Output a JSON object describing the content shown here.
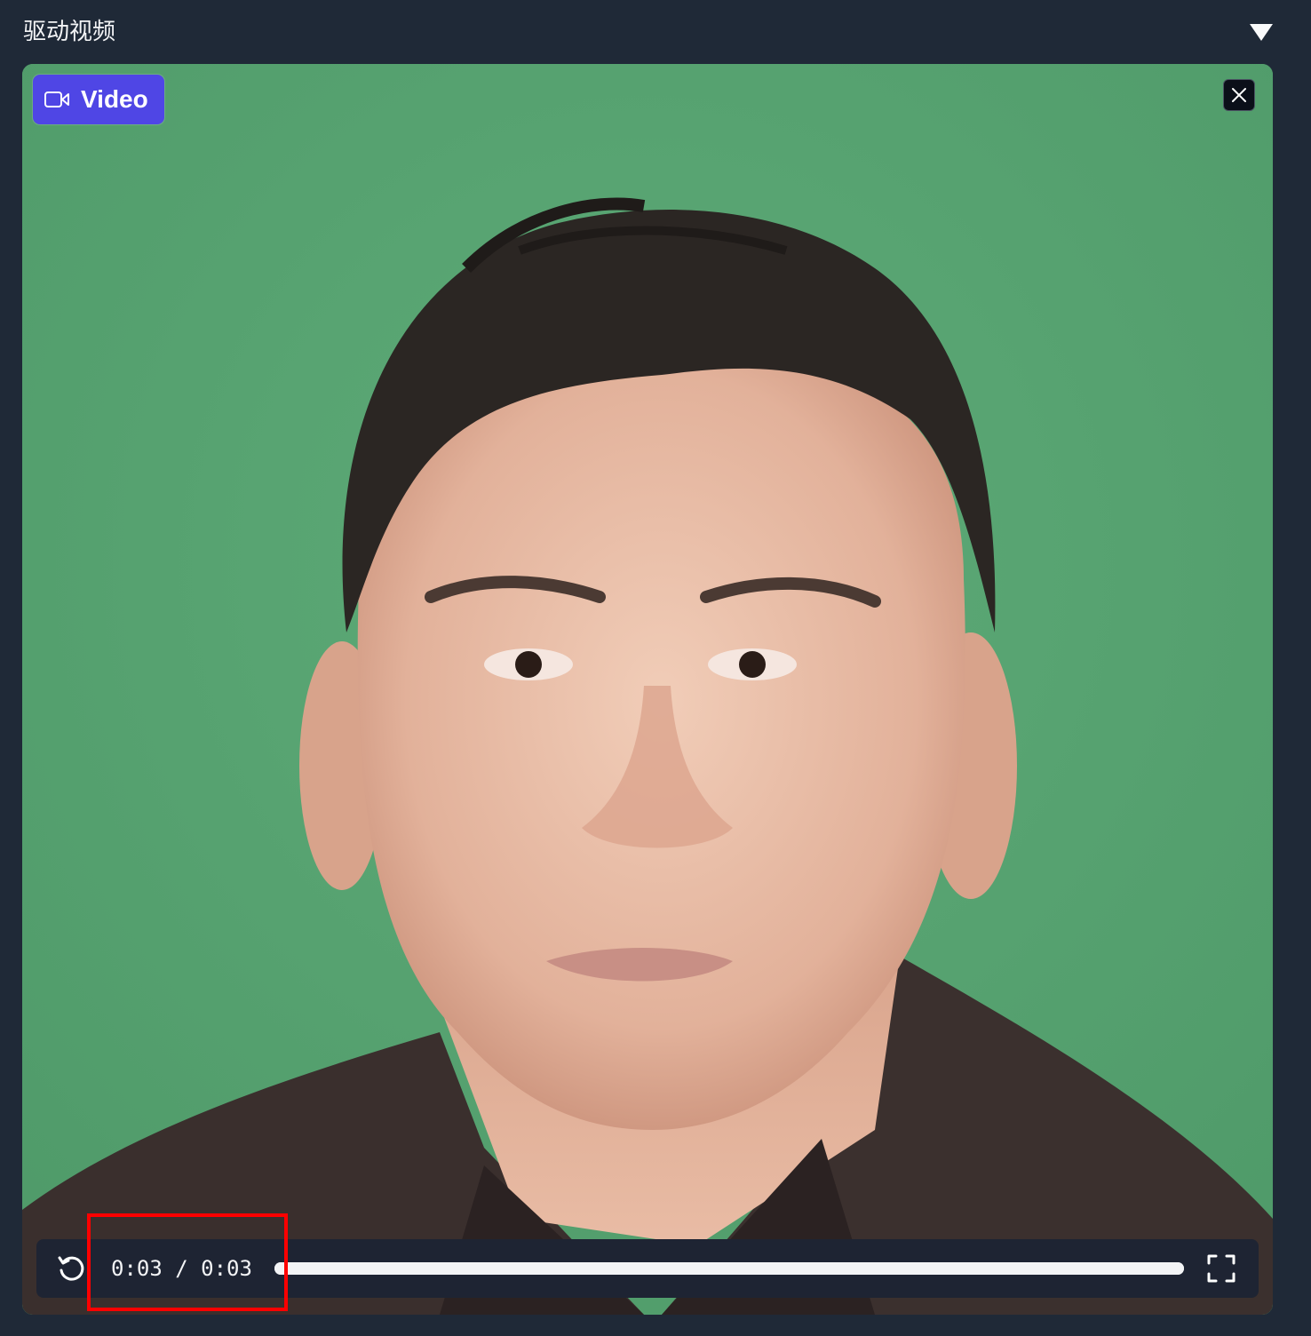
{
  "panel": {
    "title": "驱动视频",
    "collapse_icon": "triangle-down-icon"
  },
  "video": {
    "badge_label": "Video",
    "badge_icon": "video-camera-icon",
    "badge_color": "#4f46e5",
    "background_color": "#58a673",
    "close_icon": "close-icon",
    "content": "portrait-video-frame"
  },
  "player": {
    "replay_icon": "replay-icon",
    "time": "0:03 / 0:03",
    "progress": 1.0,
    "fullscreen_icon": "fullscreen-icon"
  },
  "annotation": {
    "highlight_color": "#ff0000"
  }
}
